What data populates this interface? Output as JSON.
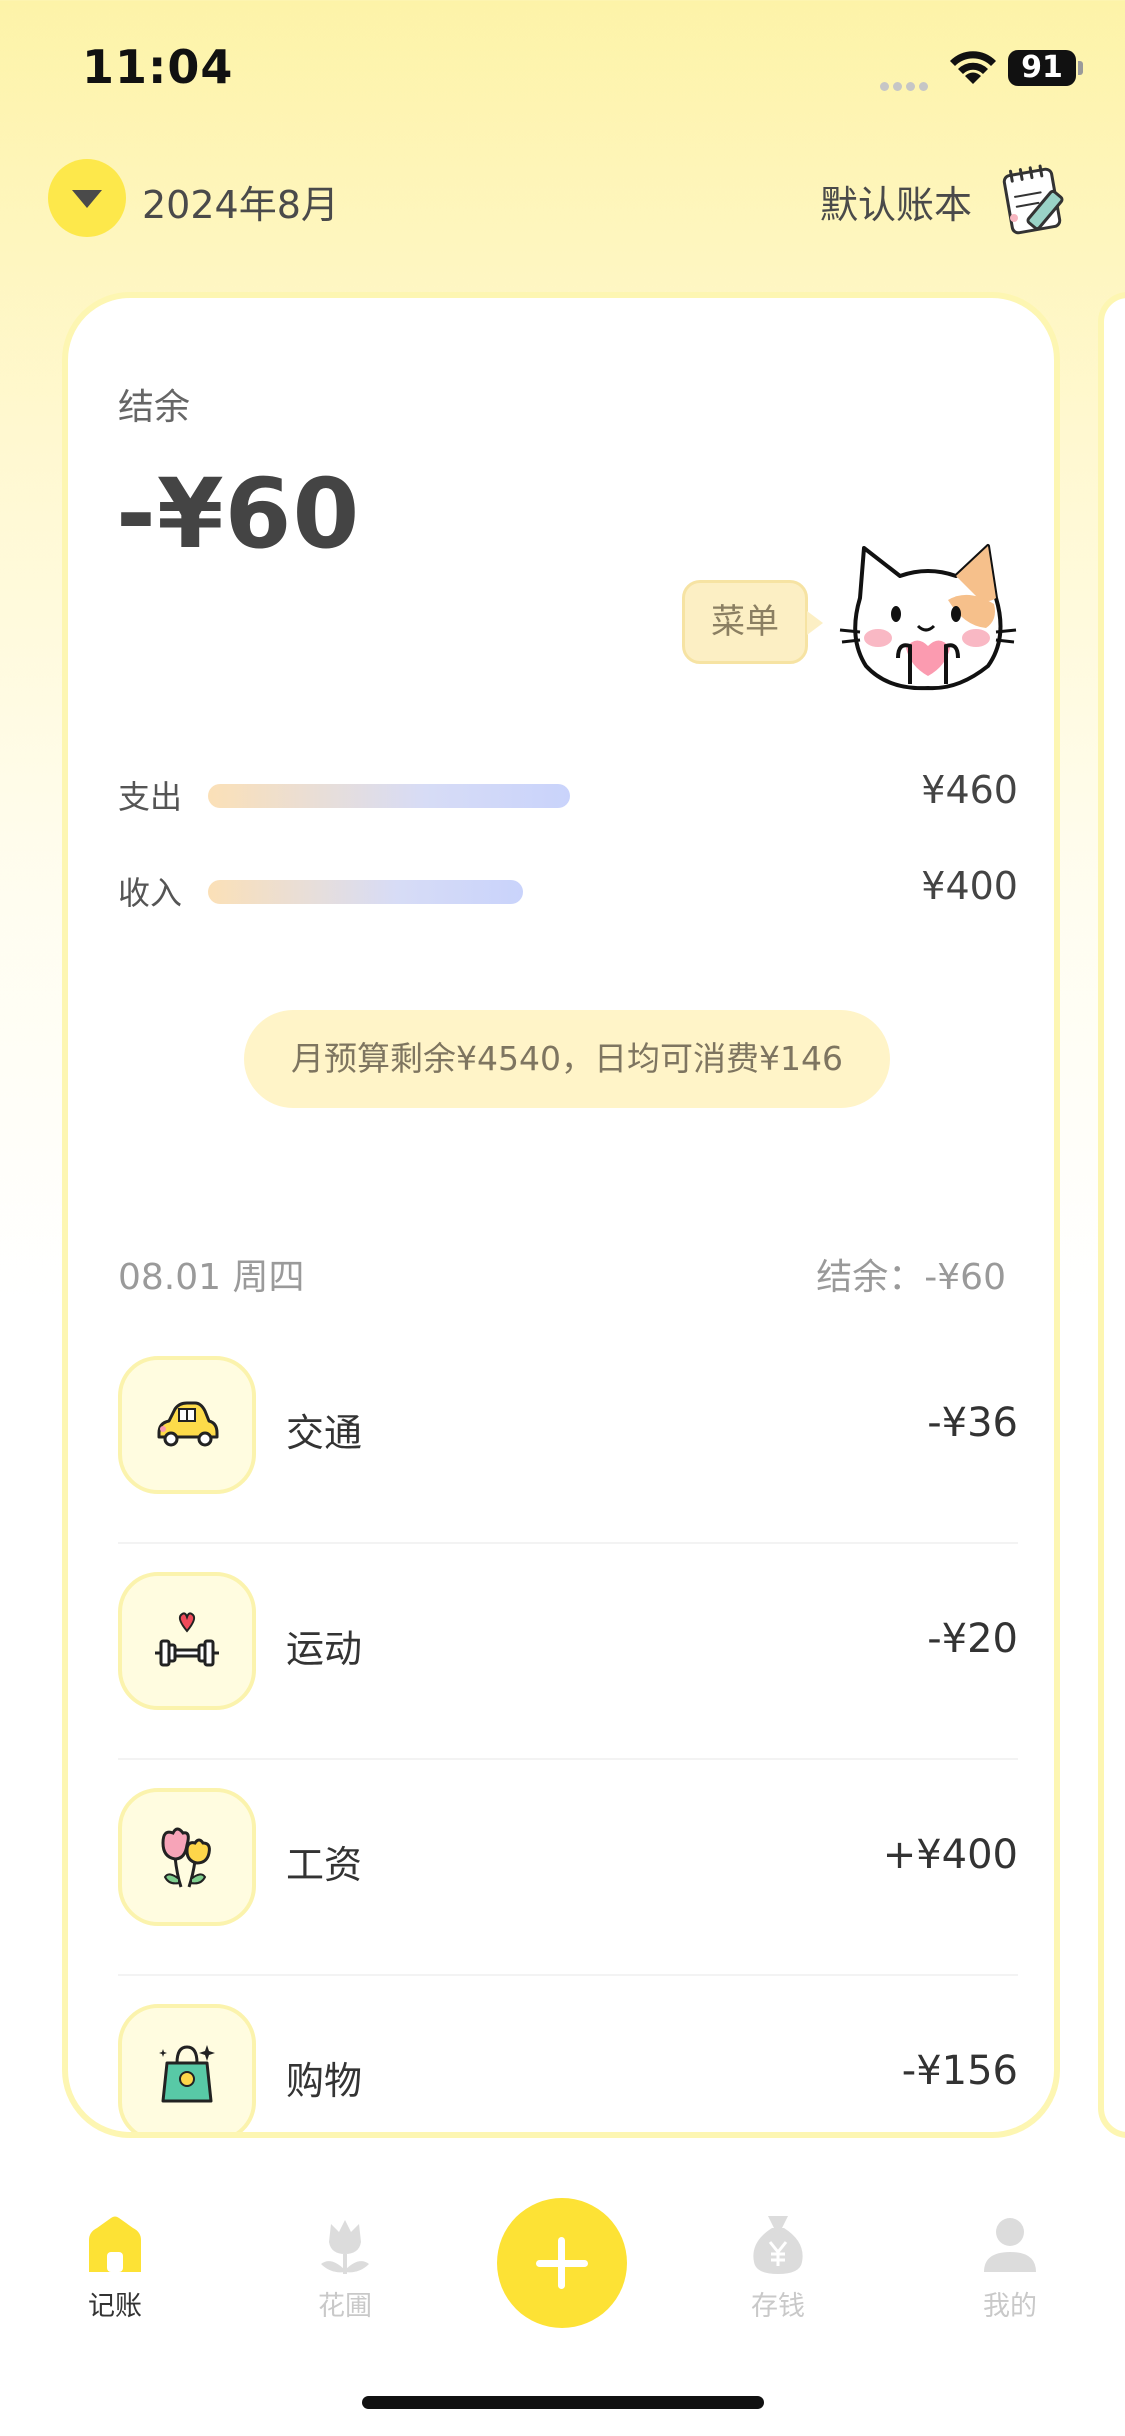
{
  "status_bar": {
    "time": "11:04",
    "battery": "91"
  },
  "header": {
    "month": "2024年8月",
    "ledger": "默认账本"
  },
  "summary": {
    "balance_label": "结余",
    "balance_value": "-¥60",
    "menu_label": "菜单",
    "expense_label": "支出",
    "expense_value": "¥460",
    "income_label": "收入",
    "income_value": "¥400",
    "expense_bar_fraction": 1.0,
    "income_bar_fraction": 0.87,
    "budget_note": "月预算剩余¥4540，日均可消费¥146"
  },
  "day": {
    "date": "08.01 周四",
    "balance": "结余：-¥60",
    "transactions": [
      {
        "icon": "car-icon",
        "name": "交通",
        "amount": "-¥36"
      },
      {
        "icon": "dumbbell-icon",
        "name": "运动",
        "amount": "-¥20"
      },
      {
        "icon": "flower-icon",
        "name": "工资",
        "amount": "+¥400"
      },
      {
        "icon": "shopping-bag-icon",
        "name": "购物",
        "amount": "-¥156"
      }
    ]
  },
  "tabbar": {
    "tabs": [
      {
        "label": "记账",
        "icon": "home-icon",
        "active": true
      },
      {
        "label": "花圃",
        "icon": "tulip-icon",
        "active": false
      },
      {
        "label": "存钱",
        "icon": "money-bag-icon",
        "active": false
      },
      {
        "label": "我的",
        "icon": "profile-icon",
        "active": false
      }
    ]
  },
  "colors": {
    "accent": "#fde235",
    "card_border": "#fdf6b2",
    "pill": "#fff4c8"
  }
}
